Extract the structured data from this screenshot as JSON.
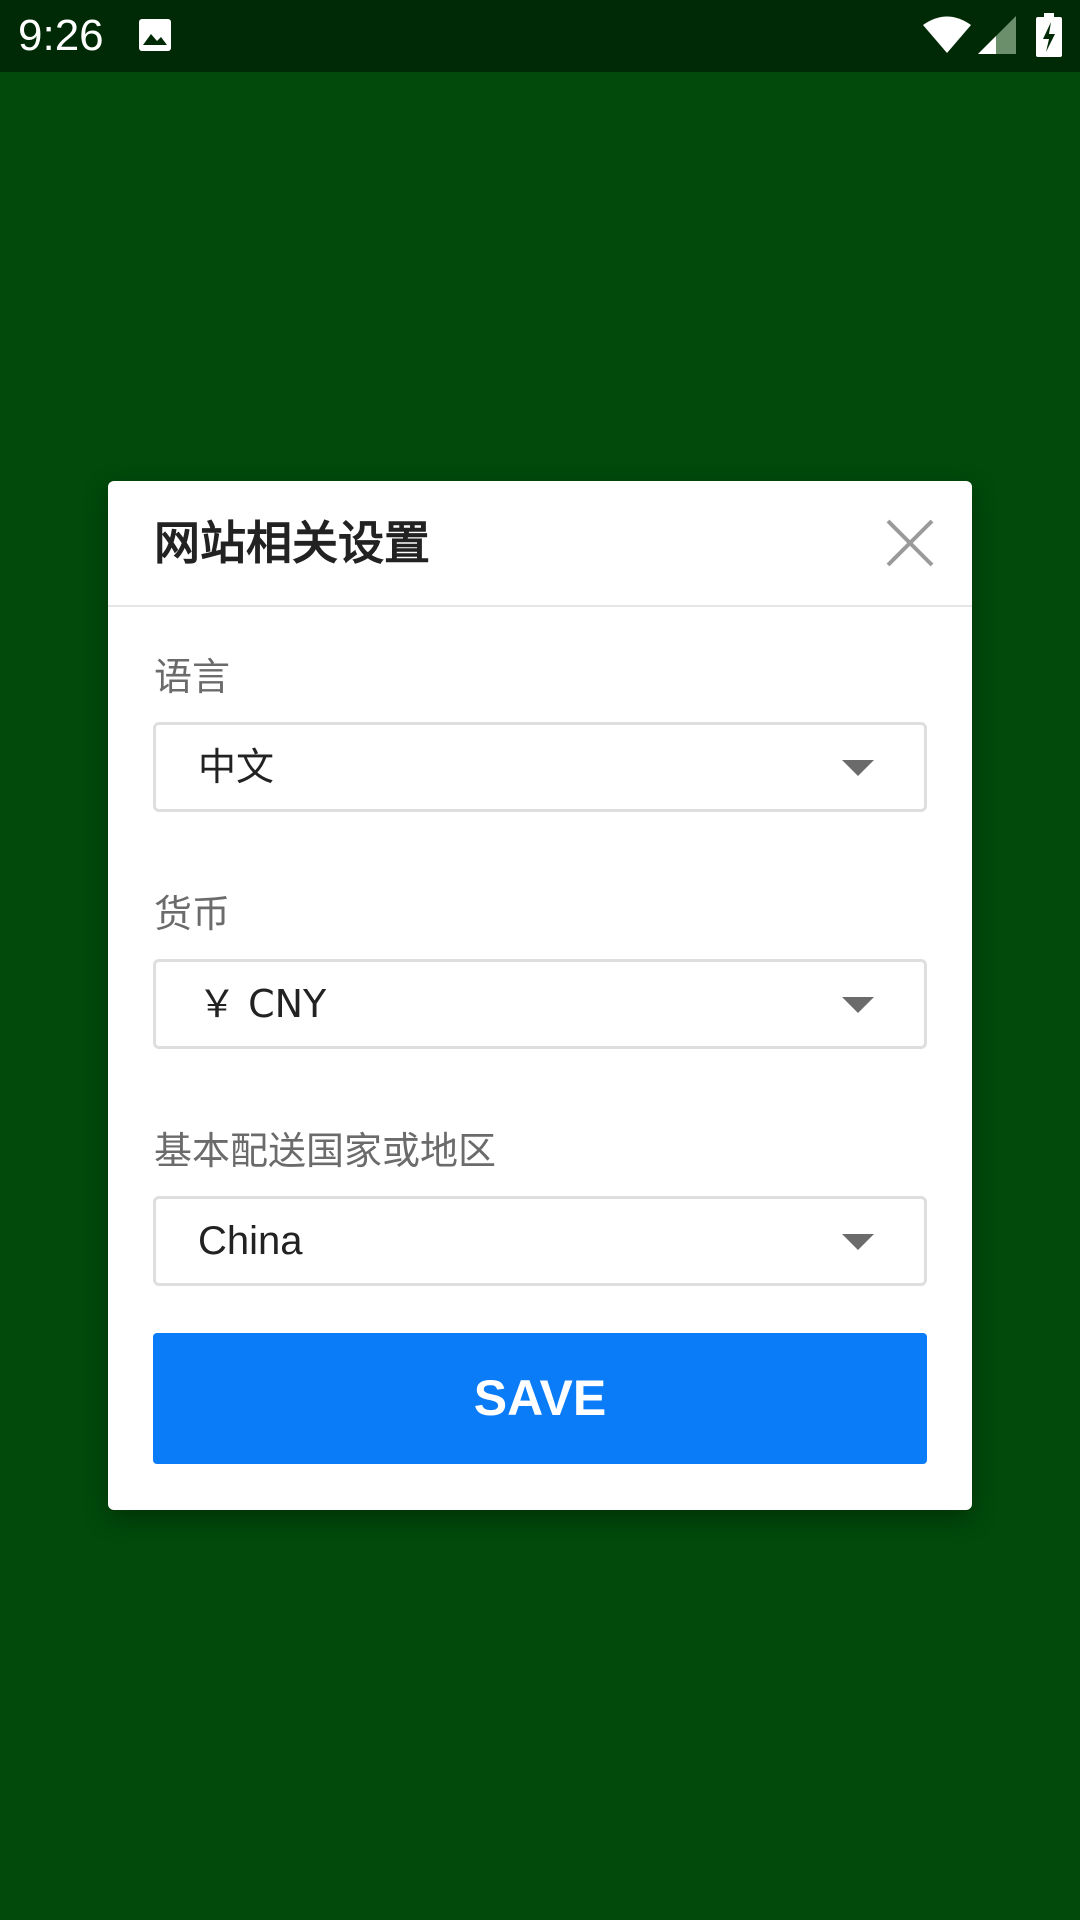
{
  "status_bar": {
    "time": "9:26",
    "icons": [
      "gallery-icon",
      "wifi-icon",
      "signal-icon",
      "battery-charging-icon"
    ]
  },
  "dialog": {
    "title": "网站相关设置",
    "close_icon": "close-icon",
    "fields": [
      {
        "label": "语言",
        "value": "中文"
      },
      {
        "label": "货币",
        "value": "￥ CNY"
      },
      {
        "label": "基本配送国家或地区",
        "value": "China"
      }
    ],
    "save_label": "SAVE"
  },
  "colors": {
    "background": "#014a0b",
    "status_bar": "#002a05",
    "dialog": "#ffffff",
    "primary_button": "#0a7cf7",
    "label_text": "#6b6b6b",
    "value_text": "#222222"
  }
}
